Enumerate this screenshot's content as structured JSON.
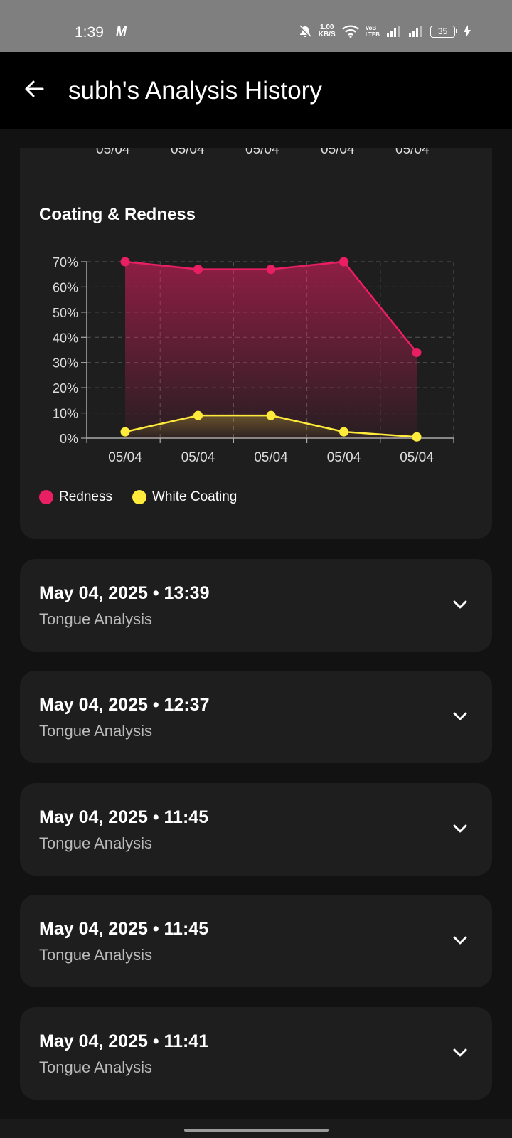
{
  "status_bar": {
    "time": "1:39",
    "carrier_icon": "M",
    "speed_value": "1.00",
    "speed_unit": "KB/S",
    "volte_top": "VoB",
    "volte_bottom": "LTEB",
    "battery": "35"
  },
  "app_bar": {
    "title": "subh's Analysis History"
  },
  "chart_top_ticks": [
    "05/04",
    "05/04",
    "05/04",
    "05/04",
    "05/04"
  ],
  "chart_data": {
    "type": "area",
    "title": "Coating & Redness",
    "categories": [
      "05/04",
      "05/04",
      "05/04",
      "05/04",
      "05/04"
    ],
    "y_ticks": [
      "0%",
      "10%",
      "20%",
      "30%",
      "40%",
      "50%",
      "60%",
      "70%"
    ],
    "ylim": [
      0,
      70
    ],
    "grid": true,
    "legend_position": "bottom-left",
    "series": [
      {
        "name": "Redness",
        "color": "#e91e63",
        "values": [
          70,
          67,
          67,
          70,
          34
        ]
      },
      {
        "name": "White Coating",
        "color": "#ffeb3b",
        "values": [
          2.5,
          9,
          9,
          2.5,
          0.5
        ]
      }
    ]
  },
  "entries": [
    {
      "date": "May 04, 2025 • 13:39",
      "subtitle": "Tongue Analysis"
    },
    {
      "date": "May 04, 2025 • 12:37",
      "subtitle": "Tongue Analysis"
    },
    {
      "date": "May 04, 2025 • 11:45",
      "subtitle": "Tongue Analysis"
    },
    {
      "date": "May 04, 2025 • 11:45",
      "subtitle": "Tongue Analysis"
    },
    {
      "date": "May 04, 2025 • 11:41",
      "subtitle": "Tongue Analysis"
    }
  ]
}
